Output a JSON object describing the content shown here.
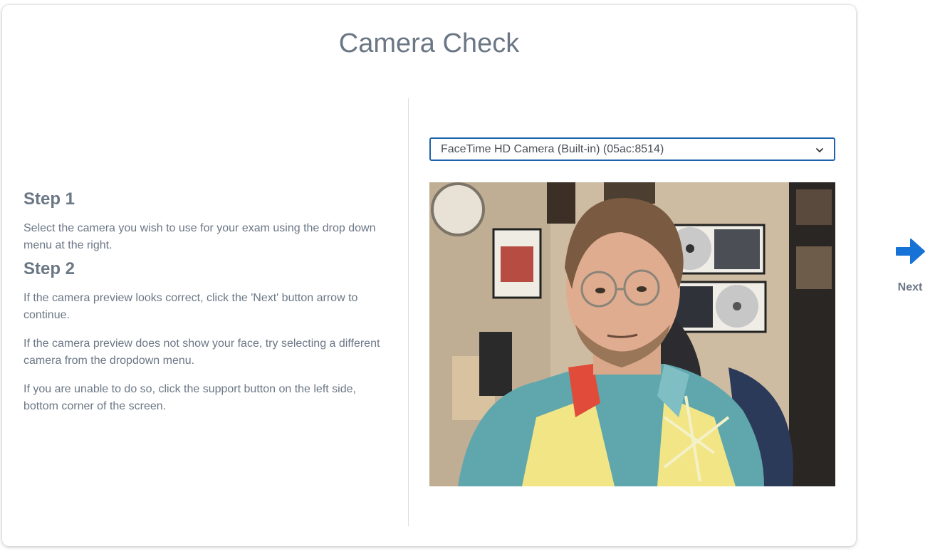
{
  "page": {
    "title": "Camera Check"
  },
  "instructions": {
    "step1": {
      "heading": "Step 1",
      "text": "Select the camera you wish to use for your exam using the drop down menu at the right."
    },
    "step2": {
      "heading": "Step 2",
      "paragraphs": [
        "If the camera preview looks correct, click the 'Next' button arrow to continue.",
        "If the camera preview does not show your face, try selecting a different camera from the dropdown menu.",
        "If you are unable to do so, click the support button on the left side, bottom corner of the screen."
      ]
    }
  },
  "camera": {
    "selected": "FaceTime HD Camera (Built-in) (05ac:8514)",
    "chevron_icon": "chevron-down-icon"
  },
  "preview": {
    "icon": "camera-preview-image"
  },
  "nav": {
    "next_label": "Next",
    "next_icon": "arrow-right-icon",
    "accent_color": "#1672d6"
  },
  "colors": {
    "text": "#6b7785",
    "select_border": "#1f63ad"
  }
}
